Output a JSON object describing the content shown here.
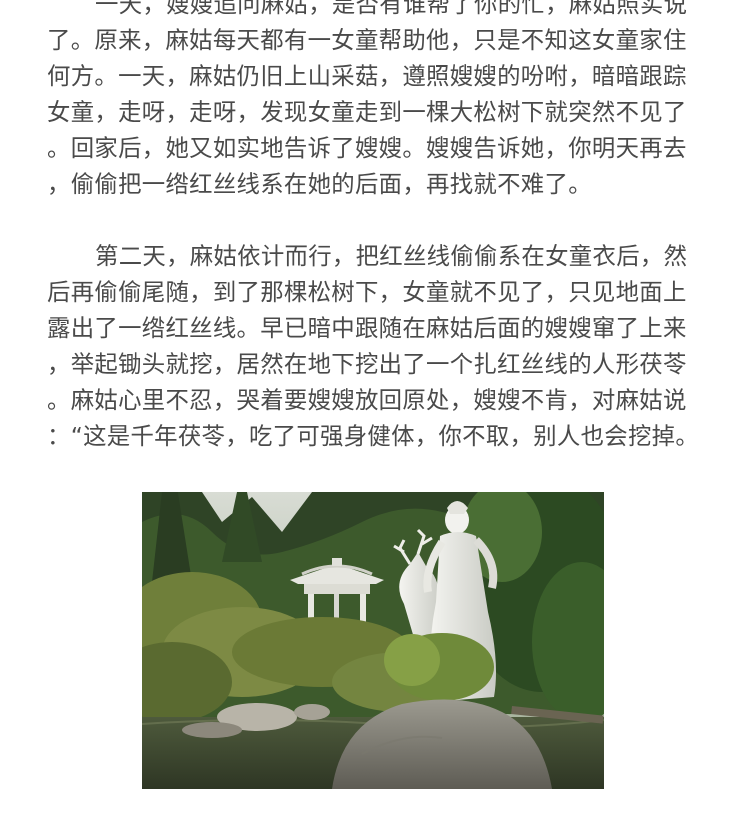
{
  "paragraph1": {
    "lines": [
      "一天，嫂嫂追问麻姑，是否有谁帮了你的忙，麻姑照实说",
      "了。原来，麻姑每天都有一女童帮助他，只是不知这女童家住",
      "何方。一天，麻姑仍旧上山采菇，遵照嫂嫂的吩咐，暗暗跟踪",
      "女童，走呀，走呀，发现女童走到一棵大松树下就突然不见了",
      "。回家后，她又如实地告诉了嫂嫂。嫂嫂告诉她，你明天再去",
      "，偷偷把一绺红丝线系在她的后面，再找就不难了。"
    ]
  },
  "paragraph2": {
    "lines": [
      "第二天，麻姑依计而行，把红丝线偷偷系在女童衣后，然",
      "后再偷偷尾随，到了那棵松树下，女童就不见了，只见地面上",
      "露出了一绺红丝线。早已暗中跟随在麻姑后面的嫂嫂窜了上来",
      "，举起锄头就挖，居然在地下挖出了一个扎红丝线的人形茯苓",
      "。麻姑心里不忍，哭着要嫂嫂放回原处，嫂嫂不肯，对麻姑说",
      "：“这是千年茯苓，吃了可强身健体，你不取，别人也会挖掉。"
    ]
  },
  "photo": {
    "subject": "white-statue-with-deer-photo"
  },
  "colors": {
    "text": "#4a4a4a",
    "background": "#ffffff"
  }
}
